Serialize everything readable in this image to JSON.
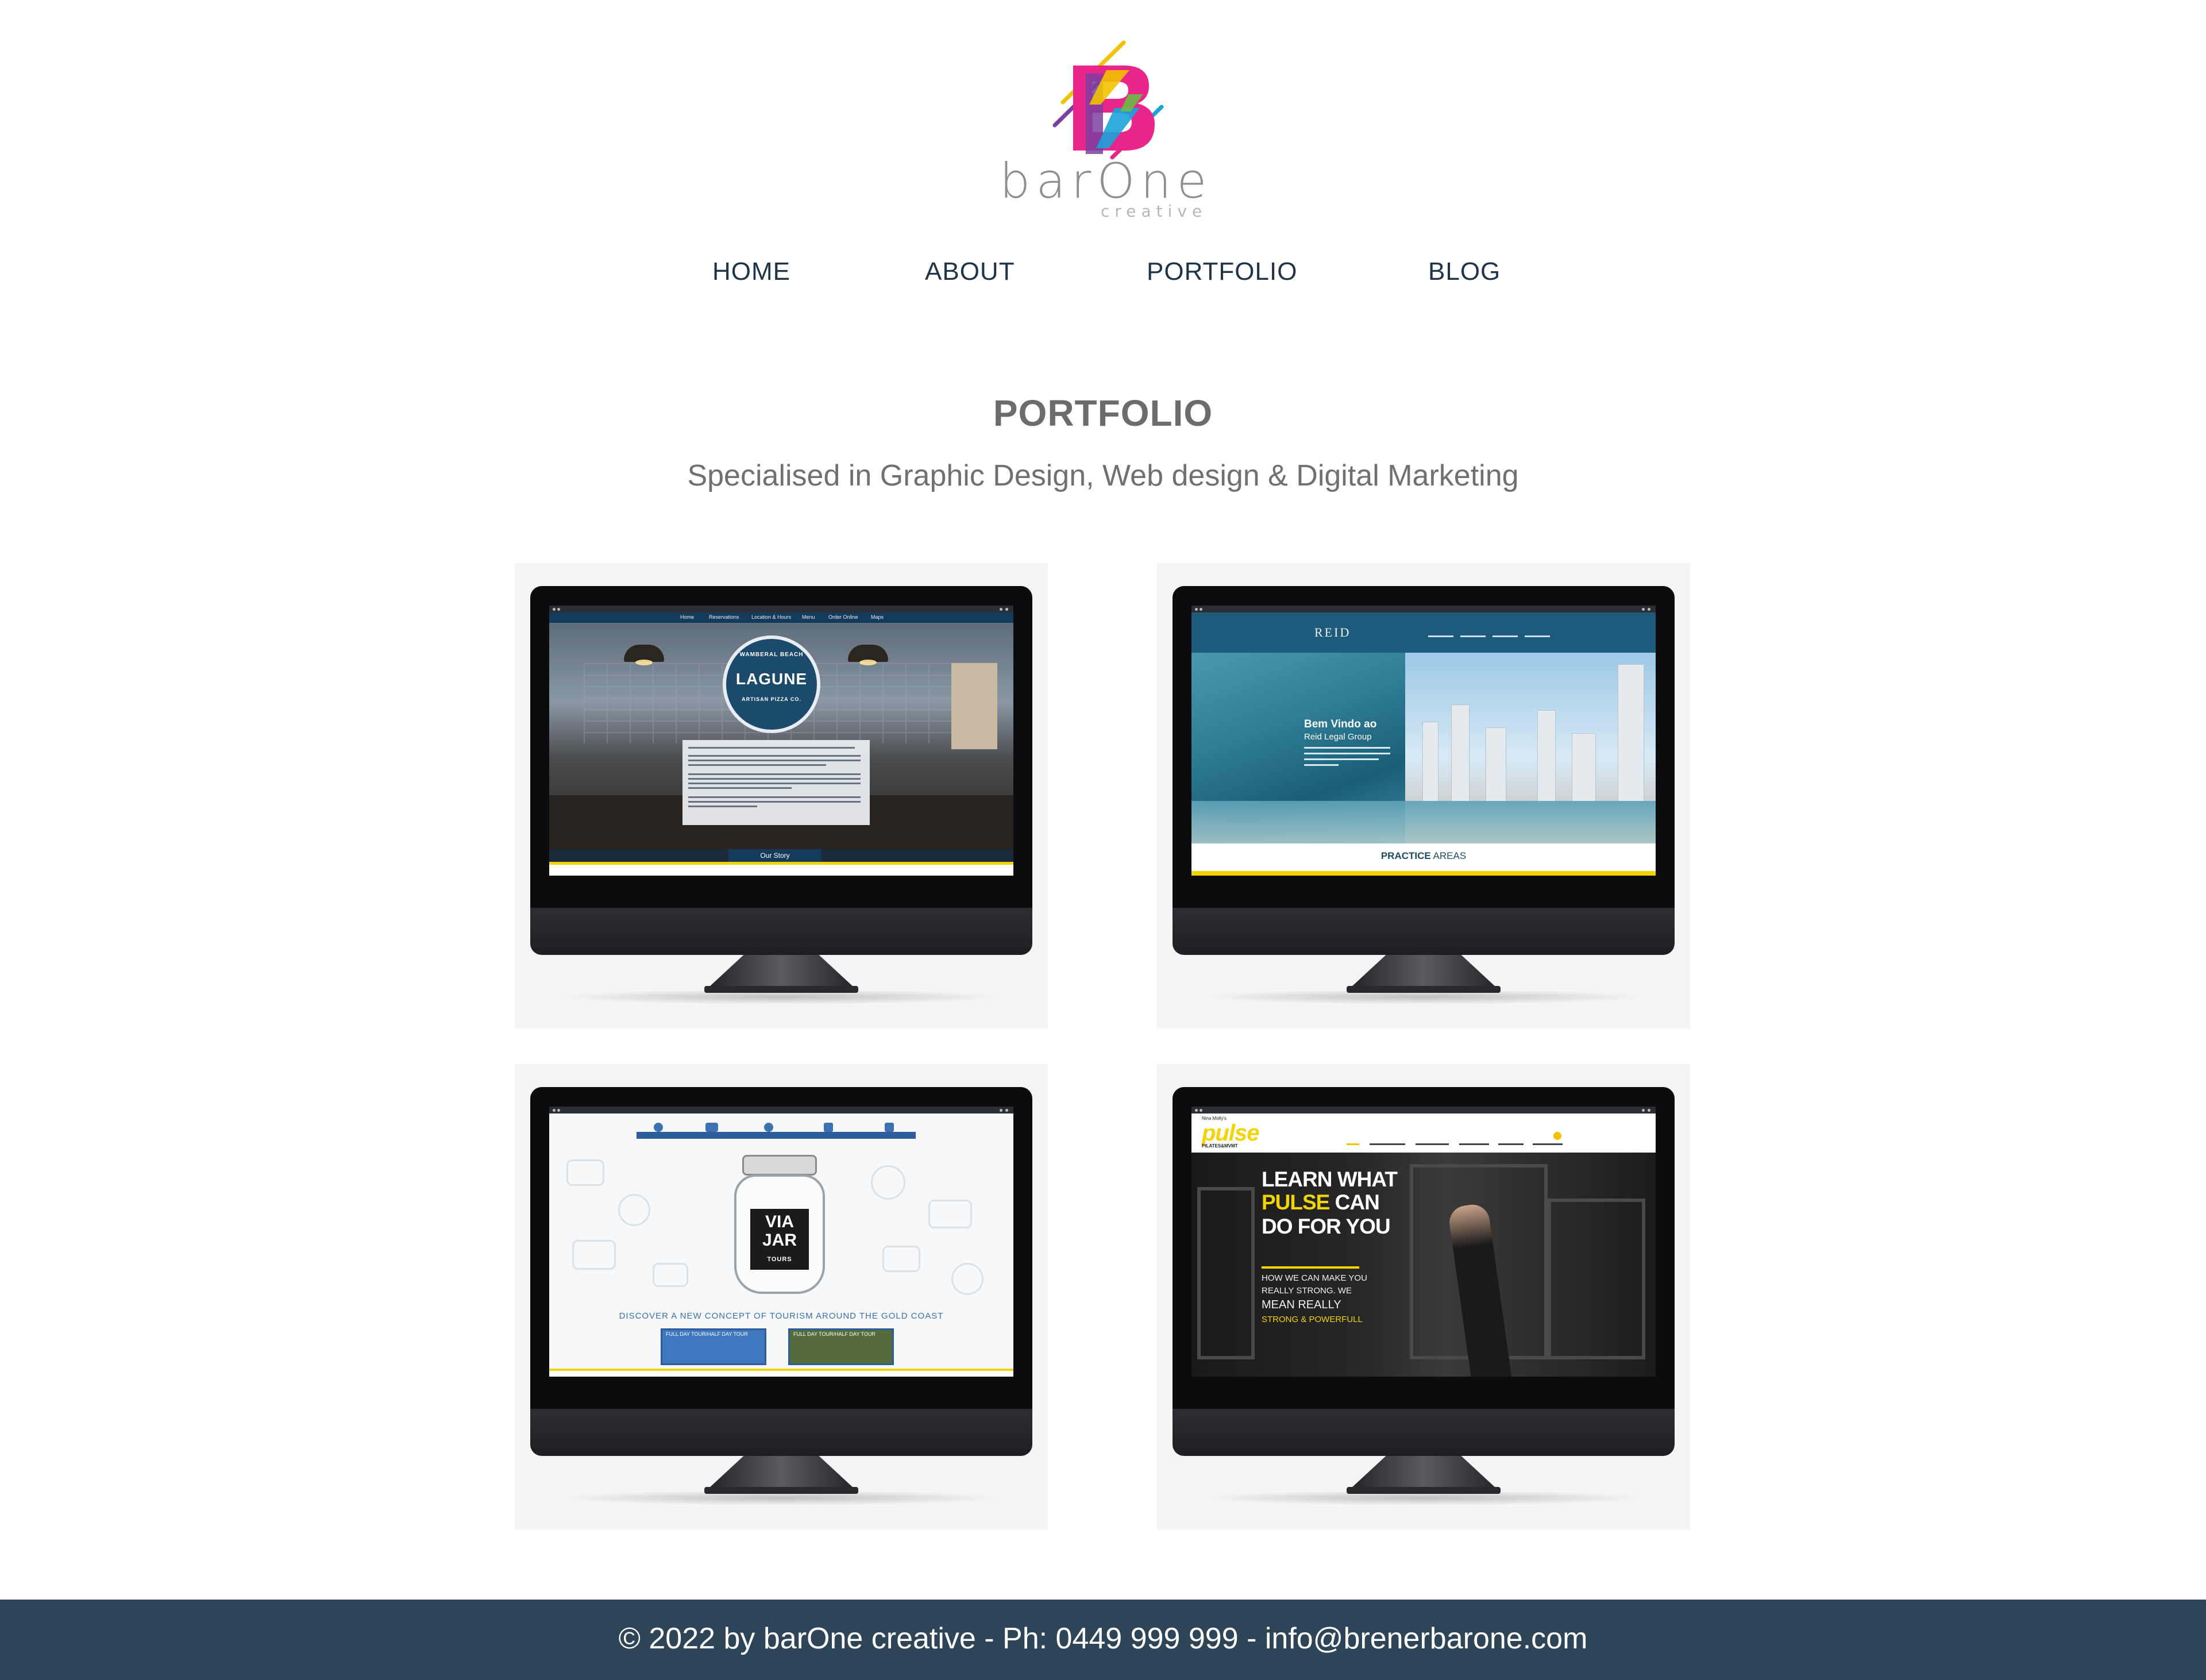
{
  "brand": {
    "name": "barOne",
    "sub": "creative",
    "colors": [
      "#f2c200",
      "#e9258a",
      "#1aa3d9",
      "#6bbd45",
      "#7b3fa0"
    ]
  },
  "nav": {
    "items": [
      {
        "label": "HOME"
      },
      {
        "label": "ABOUT"
      },
      {
        "label": "PORTFOLIO"
      },
      {
        "label": "BLOG"
      }
    ]
  },
  "main": {
    "title": "PORTFOLIO",
    "subtitle": "Specialised in Graphic Design, Web design & Digital Marketing"
  },
  "portfolio": {
    "lagune": {
      "nav": [
        "Home",
        "Reservations",
        "Location & Hours",
        "Menu",
        "Order Online",
        "Maps"
      ],
      "badge_top": "WAMBERAL BEACH",
      "badge_name": "LAGUNE",
      "badge_bottom": "ARTISAN PIZZA CO.",
      "button": "Our Story"
    },
    "reid": {
      "logo": "REID",
      "heading": "Bem Vindo ao",
      "subheading": "Reid Legal Group",
      "practice_1": "PRACTICE",
      "practice_2": "AREAS"
    },
    "viajar": {
      "jar_line1": "VIA",
      "jar_line2": "JAR",
      "jar_line3": "TOURS",
      "discover": "DISCOVER  A NEW CONCEPT OF TOURISM  AROUND THE GOLD COAST",
      "card_1": "FULL DAY TOUR/HALF DAY TOUR",
      "card_2": "FULL DAY TOUR/HALF DAY TOUR"
    },
    "pulse": {
      "brand_top": "Nina Molly's",
      "brand": "pulse",
      "brand_sub": "PILATES&MVMT",
      "h1_a": "LEARN WHAT",
      "h1_b": "PULSE",
      "h1_c": " CAN",
      "h1_d": "DO FOR YOU",
      "line_1": "HOW WE CAN MAKE YOU",
      "line_2": "REALLY STRONG. WE",
      "line_3": "MEAN REALLY",
      "line_4": "STRONG & POWERFULL"
    }
  },
  "footer": {
    "text": "© 2022 by barOne creative - Ph: 0449 999 999 - info@brenerbarone.com"
  }
}
